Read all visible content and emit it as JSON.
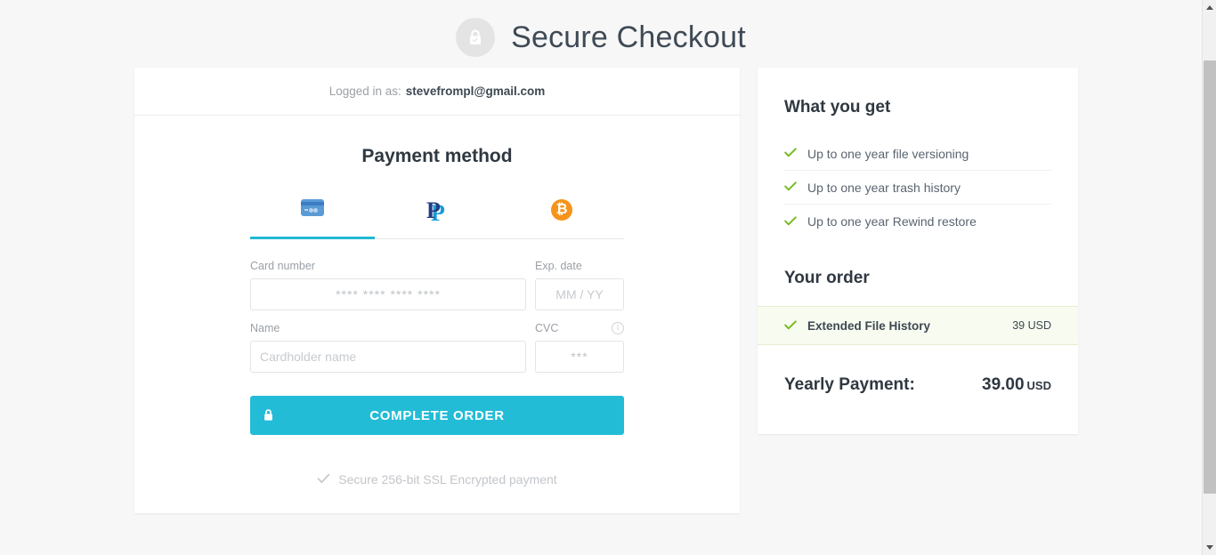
{
  "header": {
    "title": "Secure Checkout",
    "lock_icon": "lock-check-icon"
  },
  "account": {
    "label": "Logged in as:",
    "email": "stevefrompl@gmail.com"
  },
  "payment": {
    "section_title": "Payment method",
    "tabs": [
      {
        "name": "credit-card",
        "icon": "credit-card-icon",
        "active": true
      },
      {
        "name": "paypal",
        "icon": "paypal-icon",
        "active": false
      },
      {
        "name": "bitcoin",
        "icon": "bitcoin-icon",
        "active": false,
        "glyph": "₿"
      }
    ],
    "fields": {
      "card_number_label": "Card number",
      "card_number_placeholder": "**** **** **** ****",
      "card_number_value": "",
      "exp_date_label": "Exp. date",
      "exp_date_placeholder": "MM / YY",
      "exp_date_value": "",
      "name_label": "Name",
      "name_placeholder": "Cardholder name",
      "name_value": "",
      "cvc_label": "CVC",
      "cvc_placeholder": "***",
      "cvc_value": "",
      "cvc_info_icon": "info-icon",
      "cvc_info_glyph": "i"
    },
    "submit_label": "COMPLETE ORDER",
    "submit_icon": "lock-icon",
    "ssl_note": "Secure 256-bit SSL Encrypted payment",
    "ssl_icon": "check-icon",
    "accent_color": "#23bcd6"
  },
  "sidebar": {
    "benefits_title": "What you get",
    "benefits": [
      {
        "text": "Up to one year file versioning",
        "icon": "check-icon"
      },
      {
        "text": "Up to one year trash history",
        "icon": "check-icon"
      },
      {
        "text": "Up to one year Rewind restore",
        "icon": "check-icon"
      }
    ],
    "order_title": "Your order",
    "order_items": [
      {
        "name": "Extended File History",
        "price": "39 USD",
        "icon": "check-icon"
      }
    ],
    "total_label": "Yearly Payment:",
    "total_amount": "39.00",
    "total_currency": "USD",
    "check_color": "#76bc21",
    "highlight_color": "#f8fcf0"
  }
}
